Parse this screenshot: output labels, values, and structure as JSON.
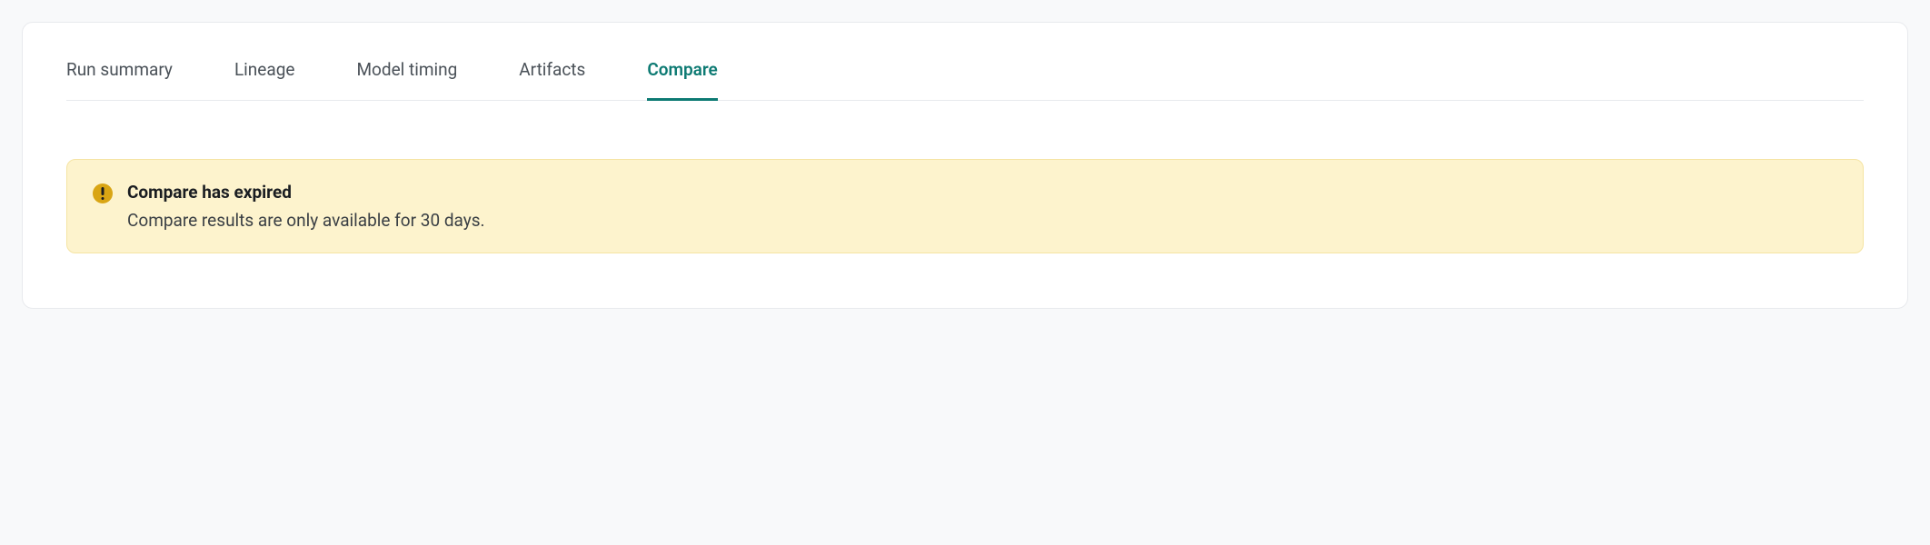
{
  "tabs": {
    "items": [
      {
        "label": "Run summary",
        "active": false
      },
      {
        "label": "Lineage",
        "active": false
      },
      {
        "label": "Model timing",
        "active": false
      },
      {
        "label": "Artifacts",
        "active": false
      },
      {
        "label": "Compare",
        "active": true
      }
    ]
  },
  "alert": {
    "title": "Compare has expired",
    "message": "Compare results are only available for 30 days."
  }
}
